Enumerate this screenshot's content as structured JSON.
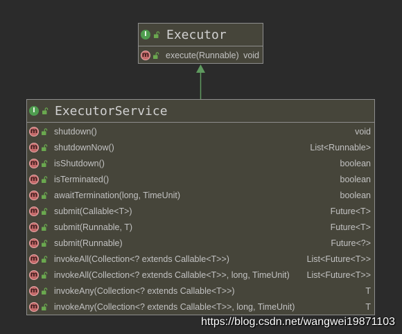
{
  "colors": {
    "canvas_background": "#2b2b2b",
    "class_fill": "#46453a",
    "class_border": "#8e8e8e",
    "title_text": "#d0d0d0",
    "member_text": "#c2c2c2",
    "inheritance_arrow": "#5f9a5f",
    "interface_icon": "#4f9d4f",
    "method_icon": "#c46a6a",
    "lock_icon": "#6aa84f",
    "watermark_text": "#ffffff"
  },
  "icons": {
    "interface": {
      "name": "interface-icon",
      "glyph": "I"
    },
    "method": {
      "name": "method-icon",
      "glyph": "m"
    },
    "visibility": {
      "name": "lock-icon"
    }
  },
  "classes": [
    {
      "name": "Executor",
      "icon": "interface-icon",
      "methods": [
        {
          "signature": "execute(Runnable)",
          "return_type": "void"
        }
      ]
    },
    {
      "name": "ExecutorService",
      "icon": "interface-icon",
      "methods": [
        {
          "signature": "shutdown()",
          "return_type": "void"
        },
        {
          "signature": "shutdownNow()",
          "return_type": "List<Runnable>"
        },
        {
          "signature": "isShutdown()",
          "return_type": "boolean"
        },
        {
          "signature": "isTerminated()",
          "return_type": "boolean"
        },
        {
          "signature": "awaitTermination(long, TimeUnit)",
          "return_type": "boolean"
        },
        {
          "signature": "submit(Callable<T>)",
          "return_type": "Future<T>"
        },
        {
          "signature": "submit(Runnable, T)",
          "return_type": "Future<T>"
        },
        {
          "signature": "submit(Runnable)",
          "return_type": "Future<?>"
        },
        {
          "signature": "invokeAll(Collection<? extends Callable<T>>)",
          "return_type": "List<Future<T>>"
        },
        {
          "signature": "invokeAll(Collection<? extends Callable<T>>, long, TimeUnit)",
          "return_type": "List<Future<T>>"
        },
        {
          "signature": "invokeAny(Collection<? extends Callable<T>>)",
          "return_type": "T"
        },
        {
          "signature": "invokeAny(Collection<? extends Callable<T>>, long, TimeUnit)",
          "return_type": "T"
        }
      ]
    }
  ],
  "relations": [
    {
      "from": 1,
      "to": 0,
      "icon": "inheritance-arrow"
    }
  ],
  "watermark": "https://blog.csdn.net/wangwei19871103"
}
